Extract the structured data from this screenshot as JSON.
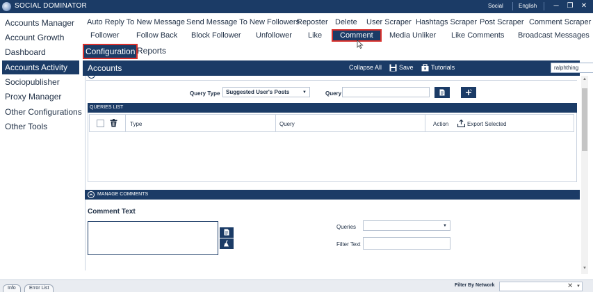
{
  "titlebar": {
    "title": "SOCIAL DOMINATOR",
    "network": "Social",
    "language": "English",
    "min_glyph": "─",
    "restore_glyph": "❐",
    "close_glyph": "✕"
  },
  "sidebar": {
    "items": [
      {
        "label": "Accounts Manager"
      },
      {
        "label": "Account Growth"
      },
      {
        "label": "Dashboard"
      },
      {
        "label": "Accounts Activity",
        "active": true
      },
      {
        "label": "Sociopublisher"
      },
      {
        "label": "Proxy Manager"
      },
      {
        "label": "Other Configurations"
      },
      {
        "label": "Other Tools"
      }
    ]
  },
  "nav": {
    "row1": [
      "Auto Reply To New Message",
      "Send Message To New Followers",
      "Reposter",
      "Delete",
      "User Scraper",
      "Hashtags Scraper",
      "Post Scraper",
      "Comment Scraper"
    ],
    "row2": [
      "Follower",
      "Follow Back",
      "Block Follower",
      "Unfollower",
      "Like",
      "Comment",
      "Media Unliker",
      "Like Comments",
      "Broadcast Messages"
    ],
    "row3": [
      "Configuration",
      "Reports"
    ]
  },
  "accounts_bar": {
    "title": "Accounts",
    "collapse_all": "Collapse All",
    "save": "Save",
    "tutorials": "Tutorials",
    "account_value": "ralphthing"
  },
  "query": {
    "type_label": "Query Type",
    "type_value": "Suggested User's Posts",
    "query_label": "Query",
    "query_value": ""
  },
  "queries_list": {
    "header": "QUERIES LIST",
    "columns": {
      "type": "Type",
      "query": "Query",
      "action": "Action",
      "export": "Export Selected"
    }
  },
  "manage_comments": {
    "header": "MANAGE COMMENTS",
    "comment_text_label": "Comment Text",
    "comment_value": "",
    "queries_label": "Queries",
    "queries_value": "",
    "filter_label": "Filter Text",
    "filter_value": ""
  },
  "bottom": {
    "tabs": [
      "Info",
      "Error List"
    ],
    "filter_label": "Filter By Network",
    "filter_value": "",
    "clear_glyph": "✕"
  },
  "colors": {
    "primary": "#1b3b66",
    "highlight": "#d9302c"
  }
}
